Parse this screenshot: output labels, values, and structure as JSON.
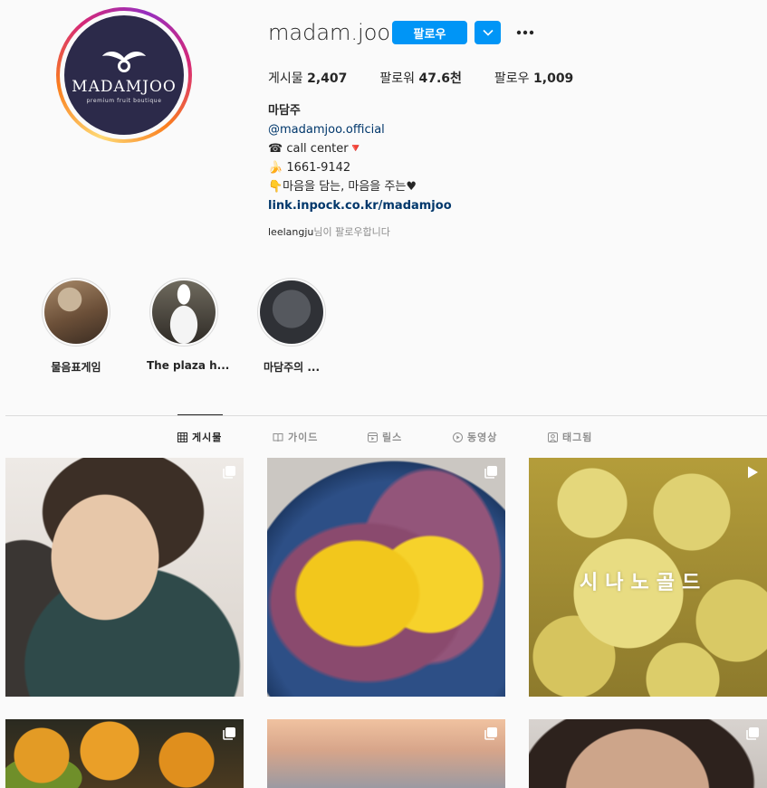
{
  "profile": {
    "username": "madam.joo",
    "follow_label": "팔로우",
    "logo_text": "MADAMJOO",
    "logo_sub": "premium fruit boutique",
    "stats": {
      "posts_label": "게시물",
      "posts_value": "2,407",
      "followers_label": "팔로워",
      "followers_value": "47.6천",
      "following_label": "팔로우",
      "following_value": "1,009"
    },
    "bio": {
      "name": "마담주",
      "handle": "@madamjoo.official",
      "line1": "☎ call center🔻",
      "line2": "🍌 1661-9142",
      "line3": "👇마음을 담는, 마음을 주는♥",
      "link": "link.inpock.co.kr/madamjoo"
    },
    "followed_by_user": "leelangju",
    "followed_by_suffix": "님이 팔로우합니다"
  },
  "highlights": [
    {
      "label": "물음표게임"
    },
    {
      "label": "The plaza h..."
    },
    {
      "label": "마담주의 ..."
    }
  ],
  "tabs": [
    {
      "label": "게시물",
      "icon": "grid-icon",
      "active": true
    },
    {
      "label": "가이드",
      "icon": "guide-icon",
      "active": false
    },
    {
      "label": "릴스",
      "icon": "reels-icon",
      "active": false
    },
    {
      "label": "동영상",
      "icon": "video-icon",
      "active": false
    },
    {
      "label": "태그됨",
      "icon": "tagged-icon",
      "active": false
    }
  ],
  "posts": [
    {
      "badge": "carousel-icon"
    },
    {
      "badge": "carousel-icon"
    },
    {
      "badge": "play-icon",
      "overlay_text": "시나노골드"
    },
    {
      "badge": "carousel-icon"
    },
    {
      "badge": "carousel-icon"
    },
    {
      "badge": "carousel-icon"
    }
  ],
  "colors": {
    "accent": "#0095f6",
    "text": "#262626",
    "muted": "#8e8e8e",
    "link": "#00376b",
    "logo_bg": "#2c2a4a"
  }
}
